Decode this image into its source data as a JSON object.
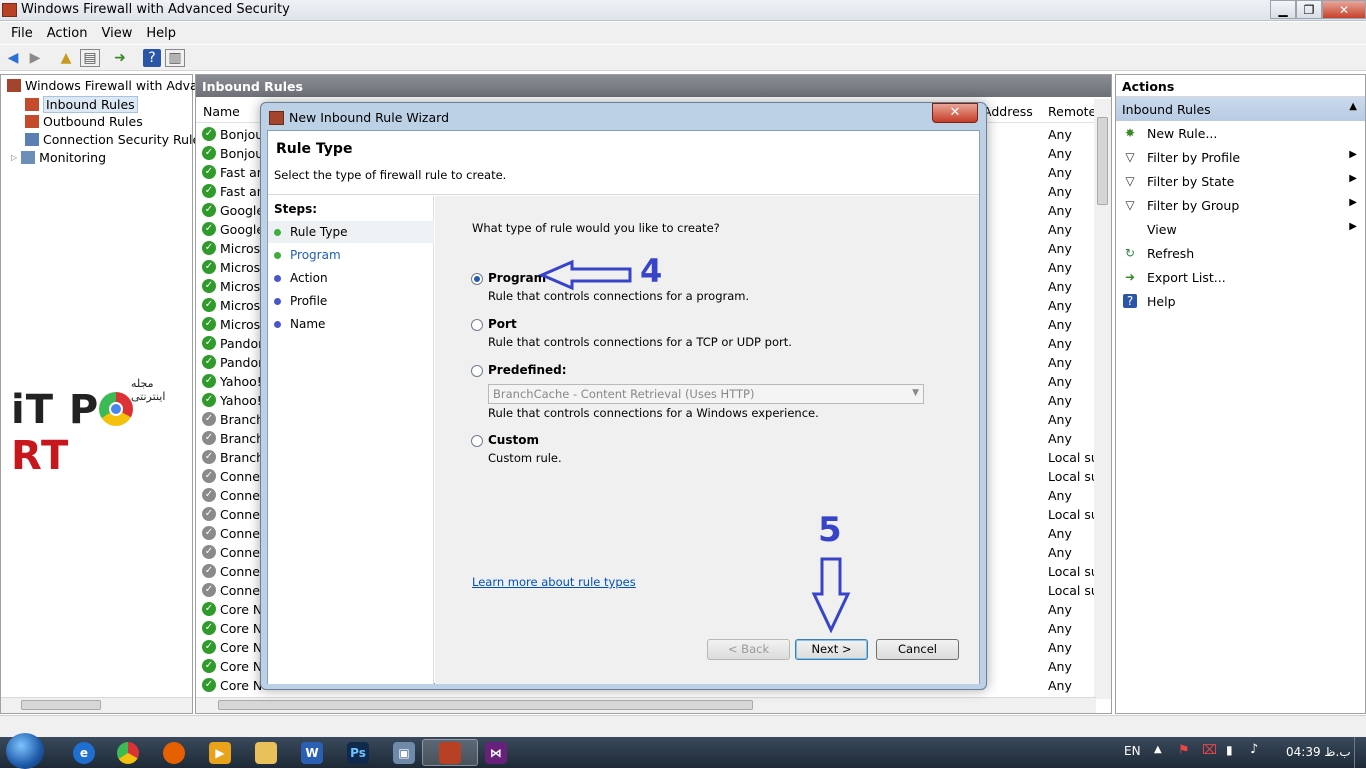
{
  "window": {
    "title": "Windows Firewall with Advanced Security"
  },
  "menu": [
    "File",
    "Action",
    "View",
    "Help"
  ],
  "tree": {
    "root": "Windows Firewall with Advance",
    "items": [
      "Inbound Rules",
      "Outbound Rules",
      "Connection Security Rules",
      "Monitoring"
    ]
  },
  "watermark": {
    "persian": "مجله اینترنتی",
    "text_it": "iT P",
    "text_rt": "RT"
  },
  "center": {
    "title": "Inbound Rules",
    "columns": {
      "name": "Name",
      "address": "Address",
      "remote": "Remote"
    },
    "rows": [
      {
        "name": "Bonjour",
        "remote": "Any",
        "enabled": true
      },
      {
        "name": "Bonjour",
        "remote": "Any",
        "enabled": true
      },
      {
        "name": "Fast and",
        "remote": "Any",
        "enabled": true
      },
      {
        "name": "Fast and",
        "remote": "Any",
        "enabled": true
      },
      {
        "name": "Google",
        "remote": "Any",
        "enabled": true
      },
      {
        "name": "Google",
        "remote": "Any",
        "enabled": true
      },
      {
        "name": "Microso",
        "remote": "Any",
        "enabled": true
      },
      {
        "name": "Microso",
        "remote": "Any",
        "enabled": true
      },
      {
        "name": "Microso",
        "remote": "Any",
        "enabled": true
      },
      {
        "name": "Microso",
        "remote": "Any",
        "enabled": true
      },
      {
        "name": "Microso",
        "remote": "Any",
        "enabled": true
      },
      {
        "name": "Pandora",
        "remote": "Any",
        "enabled": true
      },
      {
        "name": "Pandora",
        "remote": "Any",
        "enabled": true
      },
      {
        "name": "Yahoo!",
        "remote": "Any",
        "enabled": true
      },
      {
        "name": "Yahoo!",
        "remote": "Any",
        "enabled": true
      },
      {
        "name": "BranchC",
        "remote": "Any",
        "enabled": false
      },
      {
        "name": "BranchC",
        "remote": "Any",
        "enabled": false
      },
      {
        "name": "BranchC",
        "remote": "Local su",
        "enabled": false
      },
      {
        "name": "Connec",
        "remote": "Local su",
        "enabled": false
      },
      {
        "name": "Connec",
        "remote": "Any",
        "enabled": false
      },
      {
        "name": "Connec",
        "remote": "Local su",
        "enabled": false
      },
      {
        "name": "Connec",
        "remote": "Any",
        "enabled": false
      },
      {
        "name": "Connec",
        "remote": "Any",
        "enabled": false
      },
      {
        "name": "Connec",
        "remote": "Local su",
        "enabled": false
      },
      {
        "name": "Connec",
        "remote": "Local su",
        "enabled": false
      },
      {
        "name": "Core Ne",
        "remote": "Any",
        "enabled": true
      },
      {
        "name": "Core Ne",
        "remote": "Any",
        "enabled": true
      },
      {
        "name": "Core Ne",
        "remote": "Any",
        "enabled": true
      },
      {
        "name": "Core Ne",
        "remote": "Any",
        "enabled": true
      },
      {
        "name": "Core Ne",
        "remote": "Any",
        "enabled": true
      }
    ]
  },
  "actions": {
    "title": "Actions",
    "section": "Inbound Rules",
    "items": [
      {
        "label": "New Rule...",
        "icon": "new-rule-icon",
        "submenu": false
      },
      {
        "label": "Filter by Profile",
        "icon": "filter-icon",
        "submenu": true
      },
      {
        "label": "Filter by State",
        "icon": "filter-icon",
        "submenu": true
      },
      {
        "label": "Filter by Group",
        "icon": "filter-icon",
        "submenu": true
      },
      {
        "label": "View",
        "icon": "",
        "submenu": true
      },
      {
        "label": "Refresh",
        "icon": "refresh-icon",
        "submenu": false
      },
      {
        "label": "Export List...",
        "icon": "export-icon",
        "submenu": false
      },
      {
        "label": "Help",
        "icon": "help-icon",
        "submenu": false
      }
    ]
  },
  "wizard": {
    "title": "New Inbound Rule Wizard",
    "heading": "Rule Type",
    "subheading": "Select the type of firewall rule to create.",
    "steps_label": "Steps:",
    "steps": [
      {
        "label": "Rule Type",
        "current": true
      },
      {
        "label": "Program",
        "current": false
      },
      {
        "label": "Action",
        "current": false
      },
      {
        "label": "Profile",
        "current": false
      },
      {
        "label": "Name",
        "current": false
      }
    ],
    "question": "What type of rule would you like to create?",
    "options": [
      {
        "label": "Program",
        "desc": "Rule that controls connections for a program.",
        "selected": true
      },
      {
        "label": "Port",
        "desc": "Rule that controls connections for a TCP or UDP port.",
        "selected": false
      },
      {
        "label": "Predefined:",
        "desc": "Rule that controls connections for a Windows experience.",
        "selected": false
      },
      {
        "label": "Custom",
        "desc": "Custom rule.",
        "selected": false
      }
    ],
    "predefined_value": "BranchCache - Content Retrieval (Uses HTTP)",
    "learn_more": "Learn more about rule types",
    "buttons": {
      "back": "< Back",
      "next": "Next >",
      "cancel": "Cancel"
    }
  },
  "annotations": {
    "step4": "4",
    "step5": "5",
    "color": "#3743c9"
  },
  "taskbar": {
    "lang": "EN",
    "time": "04:39",
    "ampm": "ب.ظ"
  }
}
